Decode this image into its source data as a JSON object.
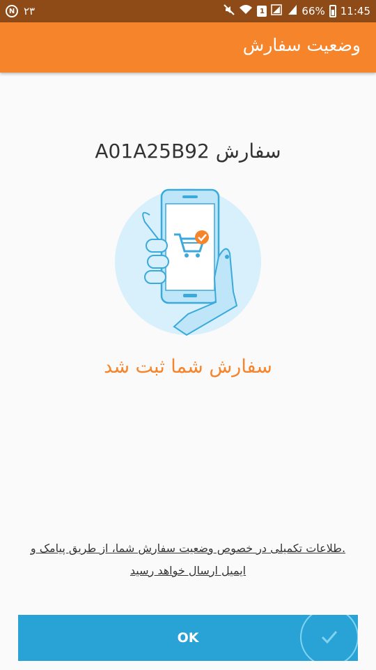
{
  "status_bar": {
    "left_number": "۲۳",
    "badge": "N",
    "sim": "1",
    "battery": "66%",
    "time": "11:45"
  },
  "header": {
    "title": "وضعیت سفارش"
  },
  "main": {
    "order_label": "سفارش A01A25B92",
    "success_message": "سفارش شما ثبت شد",
    "info_line1": ".طلاعات تکمیلی در خصوص وضعیت سفارش شما، از طریق پیامک و",
    "info_line2": "ایمیل ارسال خواهد رسید"
  },
  "footer": {
    "ok_label": "OK"
  },
  "colors": {
    "accent": "#f6842b",
    "status_bar": "#8e4a17",
    "button": "#29a3d5",
    "illustration_bg": "#d7f0fb"
  },
  "icons": [
    "mute-icon",
    "wifi-icon",
    "signal-icon",
    "battery-icon",
    "phone-cart-illustration",
    "check-icon"
  ]
}
